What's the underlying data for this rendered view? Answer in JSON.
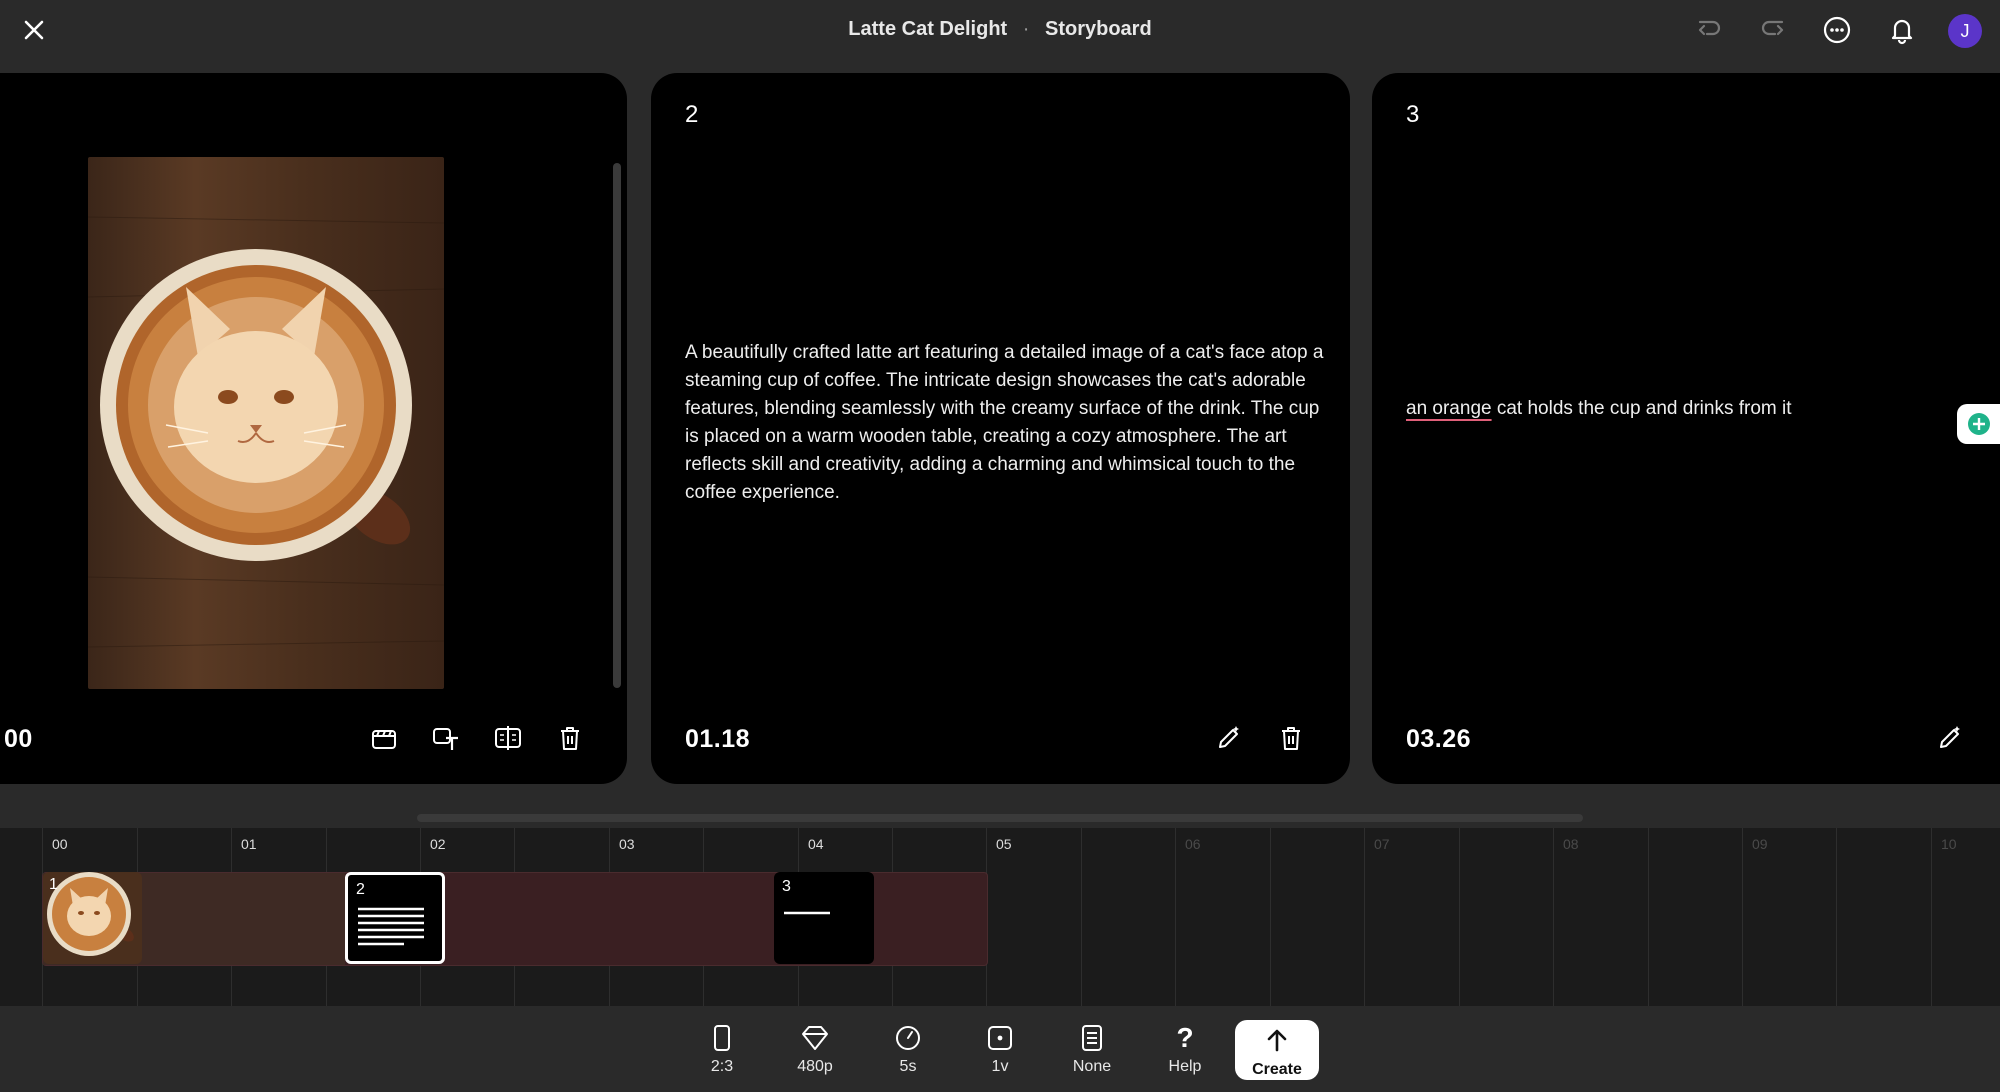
{
  "header": {
    "project_title": "Latte Cat Delight",
    "separator": "·",
    "view_title": "Storyboard",
    "avatar_initial": "J",
    "avatar_color": "#5b35c9"
  },
  "cards": [
    {
      "number": "",
      "timecode": "00",
      "text": ""
    },
    {
      "number": "2",
      "timecode": "01.18",
      "text": "A beautifully crafted latte art featuring a detailed image of a cat's face atop a steaming cup of coffee. The intricate design showcases the cat's adorable features, blending seamlessly with the creamy surface of the drink. The cup is placed on a warm wooden table, creating a cozy atmosphere. The art reflects skill and creativity, adding a charming and whimsical touch to the coffee experience."
    },
    {
      "number": "3",
      "timecode": "03.26",
      "text_highlight": "an orange",
      "text_rest": " cat holds the cup and drinks from it"
    }
  ],
  "timeline": {
    "ticks": [
      "00",
      "01",
      "02",
      "03",
      "04",
      "05",
      "06",
      "07",
      "08",
      "09",
      "10"
    ],
    "clips": [
      {
        "number": "1"
      },
      {
        "number": "2"
      },
      {
        "number": "3"
      }
    ]
  },
  "toolbar": {
    "aspect": "2:3",
    "resolution": "480p",
    "duration": "5s",
    "variations": "1v",
    "preset": "None",
    "help": "Help",
    "create": "Create"
  },
  "colors": {
    "background": "#2a2a2a",
    "card": "#000000",
    "timeline_clip": "#3a1f22",
    "highlight_underline": "#e0607a",
    "badge": "#1fb38a"
  }
}
